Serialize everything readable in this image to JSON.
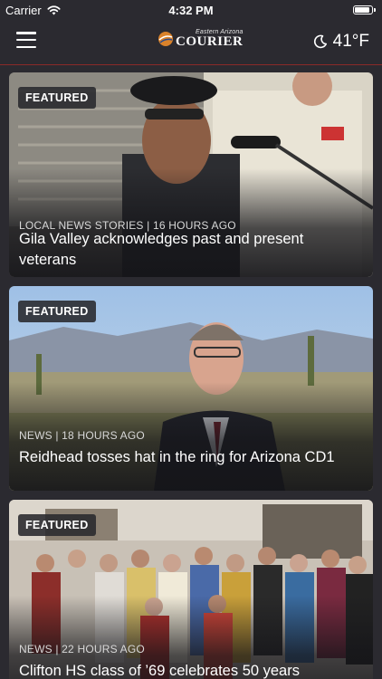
{
  "status_bar": {
    "carrier": "Carrier",
    "time": "4:32 PM",
    "battery_level": 0.95
  },
  "header": {
    "logo_small": "Eastern Arizona",
    "logo_big": "COURIER",
    "weather_icon": "moon-icon",
    "temperature": "41°F",
    "menu_icon": "hamburger-menu-icon"
  },
  "articles": [
    {
      "badge": "FEATURED",
      "meta": "LOCAL NEWS STORIES | 16 HOURS AGO",
      "title": "Gila Valley acknowledges past and present veterans"
    },
    {
      "badge": "FEATURED",
      "meta": "NEWS | 18 HOURS AGO",
      "title": "Reidhead tosses hat in the ring for Arizona CD1"
    },
    {
      "badge": "FEATURED",
      "meta": "NEWS | 22 HOURS AGO",
      "title": "Clifton HS class of ’69 celebrates 50 years"
    }
  ],
  "colors": {
    "background": "#2b2a30",
    "header_rule": "#8a2a28",
    "badge_bg": "#28282c"
  }
}
